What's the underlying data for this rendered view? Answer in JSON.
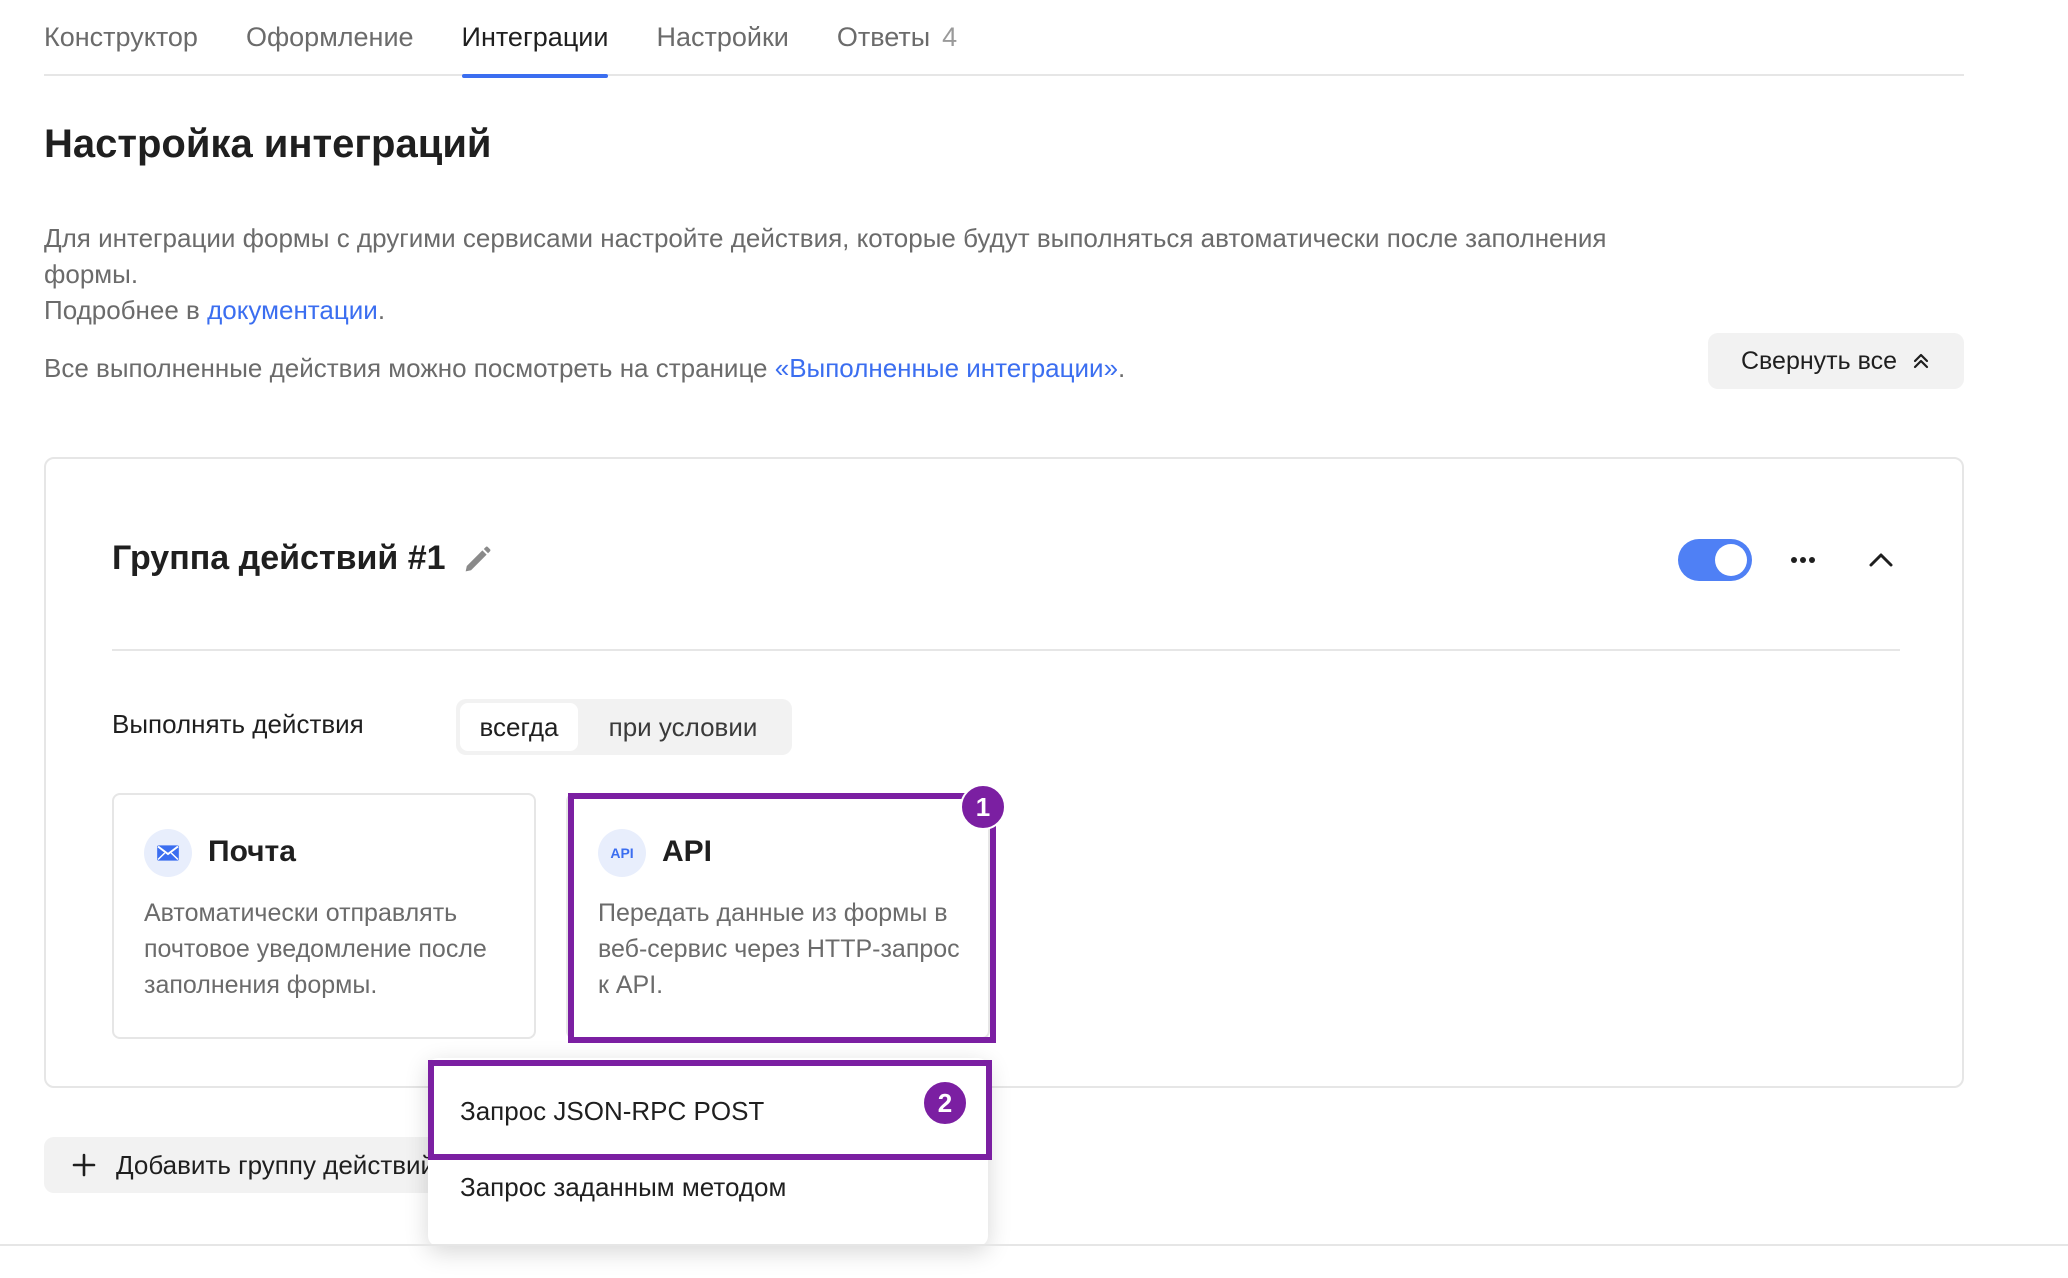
{
  "tabs": [
    {
      "label": "Конструктор",
      "active": false
    },
    {
      "label": "Оформление",
      "active": false
    },
    {
      "label": "Интеграции",
      "active": true
    },
    {
      "label": "Настройки",
      "active": false
    },
    {
      "label": "Ответы",
      "active": false,
      "count": "4"
    }
  ],
  "page": {
    "title": "Настройка интеграций",
    "description_1": "Для интеграции формы с другими сервисами настройте действия, которые будут выполняться автоматически после заполнения формы.",
    "more_prefix": "Подробнее в ",
    "more_link": "документации",
    "more_suffix": ".",
    "executed_prefix": "Все выполненные действия можно посмотреть на странице ",
    "executed_link": "«Выполненные интеграции»",
    "executed_suffix": ".",
    "collapse_all": "Свернуть все"
  },
  "group": {
    "title": "Группа действий #1",
    "enabled": true,
    "run_label": "Выполнять действия",
    "run_options": [
      "всегда",
      "при условии"
    ],
    "run_selected": "всегда",
    "actions": [
      {
        "icon": "mail-icon",
        "title": "Почта",
        "description": "Автоматически отправлять почтовое уведомление после заполнения формы."
      },
      {
        "icon": "api-icon",
        "icon_text": "API",
        "title": "API",
        "description": "Передать данные из формы в веб-сервис через HTTP-запрос к API."
      }
    ]
  },
  "add_group": "Добавить группу действий",
  "menu": {
    "items": [
      "Запрос JSON-RPC POST",
      "Запрос заданным методом"
    ]
  },
  "annotations": {
    "badge_1": "1",
    "badge_2": "2"
  },
  "colors": {
    "accent": "#3b6ef0",
    "toggle": "#4f80f5",
    "highlight": "#7b1fa2"
  }
}
